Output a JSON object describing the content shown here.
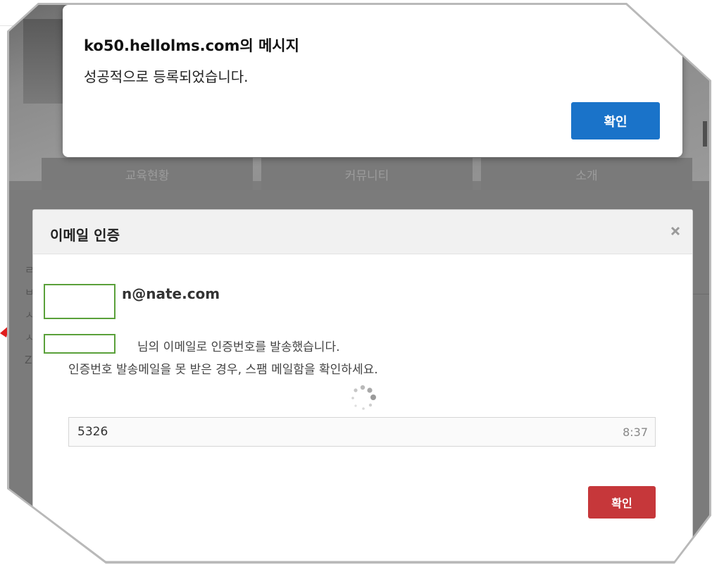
{
  "alert": {
    "title": "ko50.hellolms.com의 메시지",
    "message": "성공적으로 등록되었습니다.",
    "ok_label": "확인",
    "accent": "#1a73c9"
  },
  "background_nav": {
    "tabs": [
      "교육현황",
      "커뮤니티",
      "소개"
    ]
  },
  "background_page": {
    "side_chars": [
      "ㄹ",
      "ㅂ",
      "ㅅ",
      "ㅅ",
      "Z"
    ]
  },
  "modal": {
    "title": "이메일 인증",
    "close_icon": "close-icon",
    "email_suffix": "n@nate.com",
    "message_sent": "님의 이메일로 인증번호를 발송했습니다.",
    "message_spam": "인증번호 발송메일을 못 받은 경우, 스팸 메일함을 확인하세요.",
    "code_value": "5326",
    "timer": "8:37",
    "confirm_label": "확인",
    "confirm_color": "#c6373a"
  }
}
